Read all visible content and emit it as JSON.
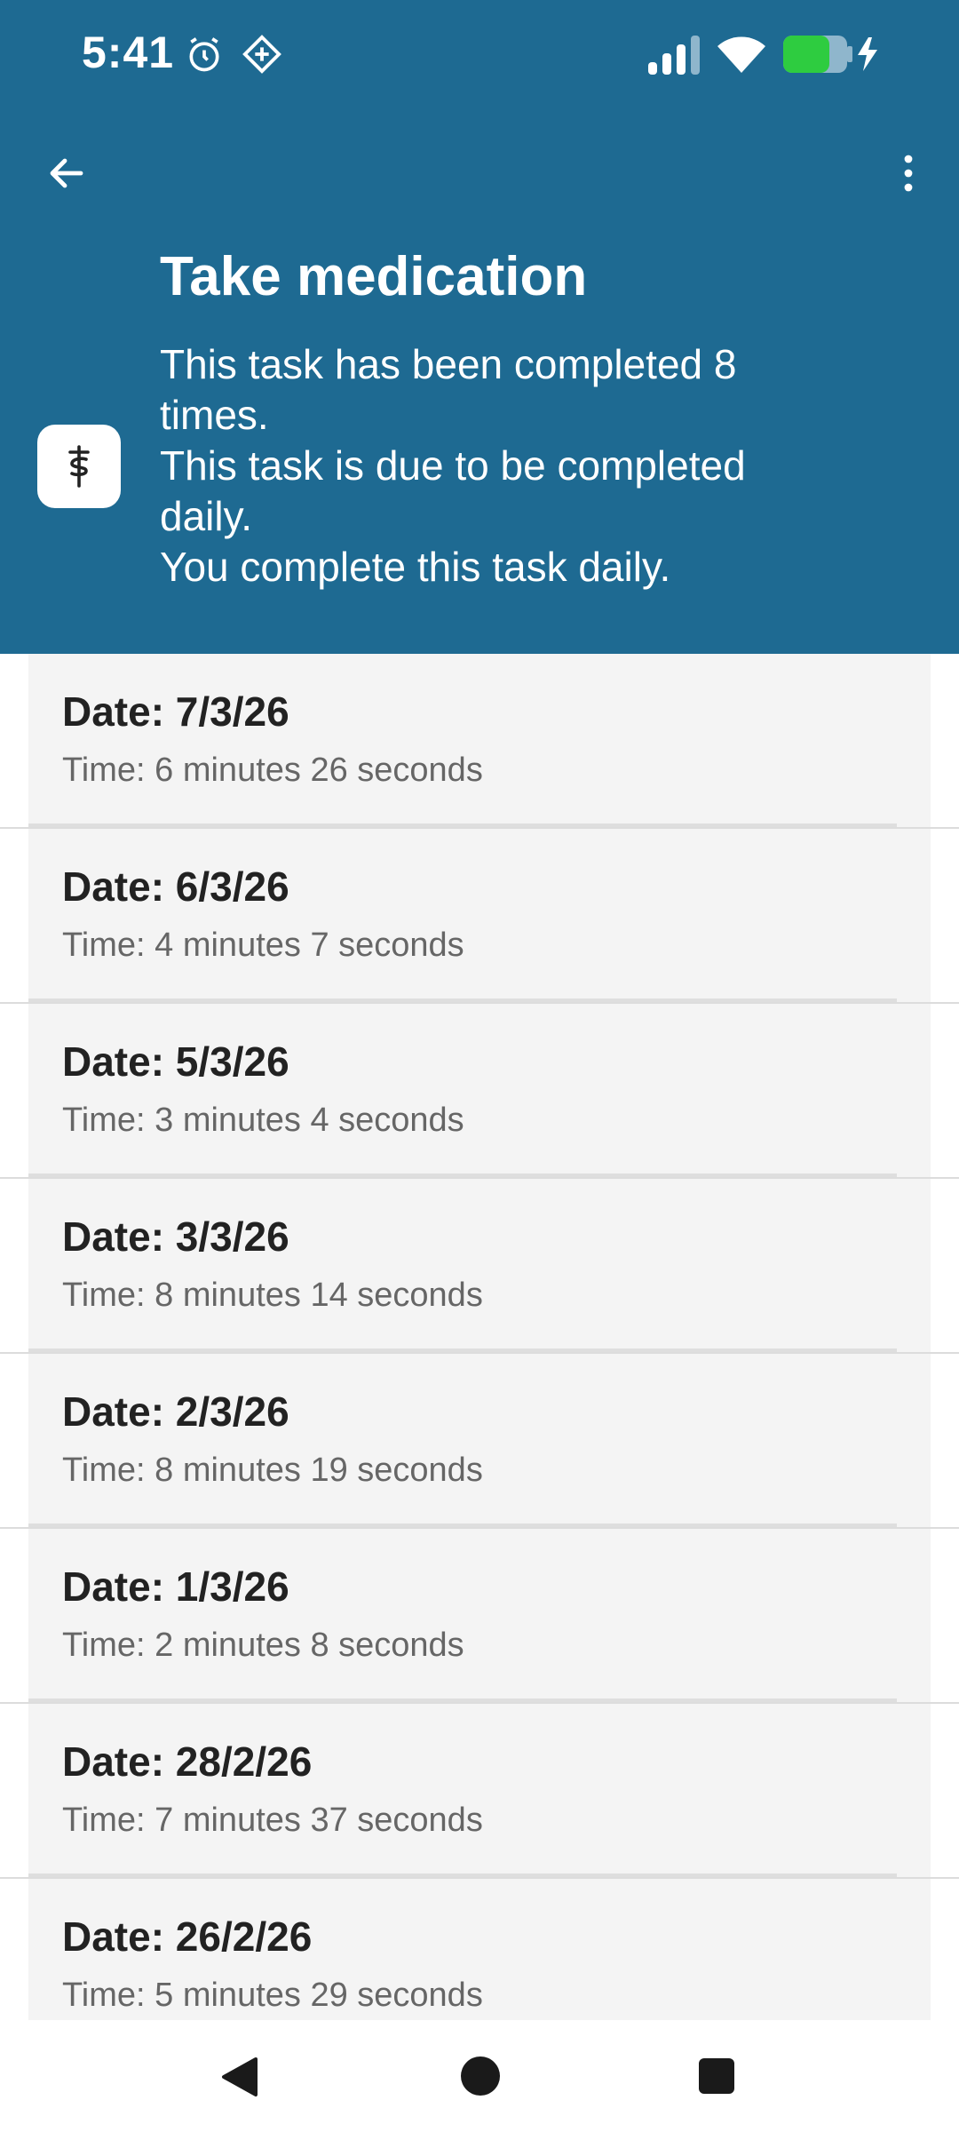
{
  "status_bar": {
    "time": "5:41",
    "icons": [
      "alarm-icon",
      "nav-diamond-icon",
      "signal-icon",
      "wifi-icon",
      "battery-charging-icon"
    ],
    "battery_color": "#2ecc40"
  },
  "toolbar": {
    "back_icon": "arrow-left-icon",
    "more_icon": "more-vertical-icon"
  },
  "task": {
    "icon": "medical-caduceus-icon",
    "title": "Take medication",
    "description_lines": [
      "This task has been completed 8",
      "times.",
      "This task is due to be completed",
      "daily.",
      "You complete this task daily."
    ]
  },
  "history": [
    {
      "date": "Date: 7/3/26",
      "time": "Time: 6 minutes 26 seconds"
    },
    {
      "date": "Date: 6/3/26",
      "time": "Time: 4 minutes 7 seconds"
    },
    {
      "date": "Date: 5/3/26",
      "time": "Time: 3 minutes 4 seconds"
    },
    {
      "date": "Date: 3/3/26",
      "time": "Time: 8 minutes 14 seconds"
    },
    {
      "date": "Date: 2/3/26",
      "time": "Time: 8 minutes 19 seconds"
    },
    {
      "date": "Date: 1/3/26",
      "time": "Time: 2 minutes 8 seconds"
    },
    {
      "date": "Date: 28/2/26",
      "time": "Time: 7 minutes 37 seconds"
    },
    {
      "date": "Date: 26/2/26",
      "time": "Time: 5 minutes 29 seconds"
    }
  ],
  "colors": {
    "header_bg": "#1e6a92",
    "list_bg": "#f4f4f4"
  }
}
